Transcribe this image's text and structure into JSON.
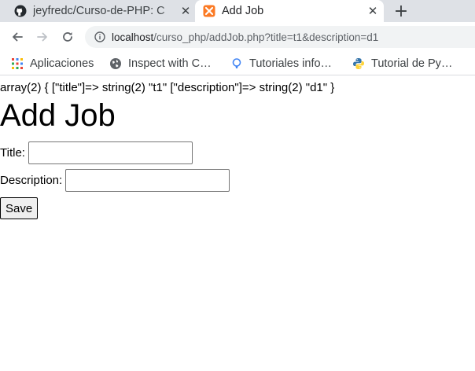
{
  "tabs": [
    {
      "title": "jeyfredc/Curso-de-PHP: C",
      "favicon": "github-icon"
    },
    {
      "title": "Add Job",
      "favicon": "xampp-icon"
    }
  ],
  "new_tab_label": "+",
  "close_label": "✕",
  "address_bar": {
    "host": "localhost",
    "path": "/curso_php/addJob.php?title=t1&description=d1"
  },
  "bookmarks": [
    {
      "label": "Aplicaciones",
      "icon": "apps-grid-icon"
    },
    {
      "label": "Inspect with C…",
      "icon": "globe-icon"
    },
    {
      "label": "Tutoriales info…",
      "icon": "bulb-icon"
    },
    {
      "label": "Tutorial de Py…",
      "icon": "python-icon"
    }
  ],
  "page": {
    "var_dump": "array(2) { [\"title\"]=> string(2) \"t1\" [\"description\"]=> string(2) \"d1\" }",
    "heading": "Add Job",
    "form": {
      "title_label": "Title:",
      "title_value": "",
      "description_label": "Description:",
      "description_value": "",
      "save_label": "Save"
    }
  },
  "colors": {
    "tab_strip": "#dee1e6",
    "omnibox": "#f1f3f4",
    "xampp_orange": "#fb7a24",
    "python_blue": "#3776ab",
    "python_yellow": "#ffd43b"
  }
}
